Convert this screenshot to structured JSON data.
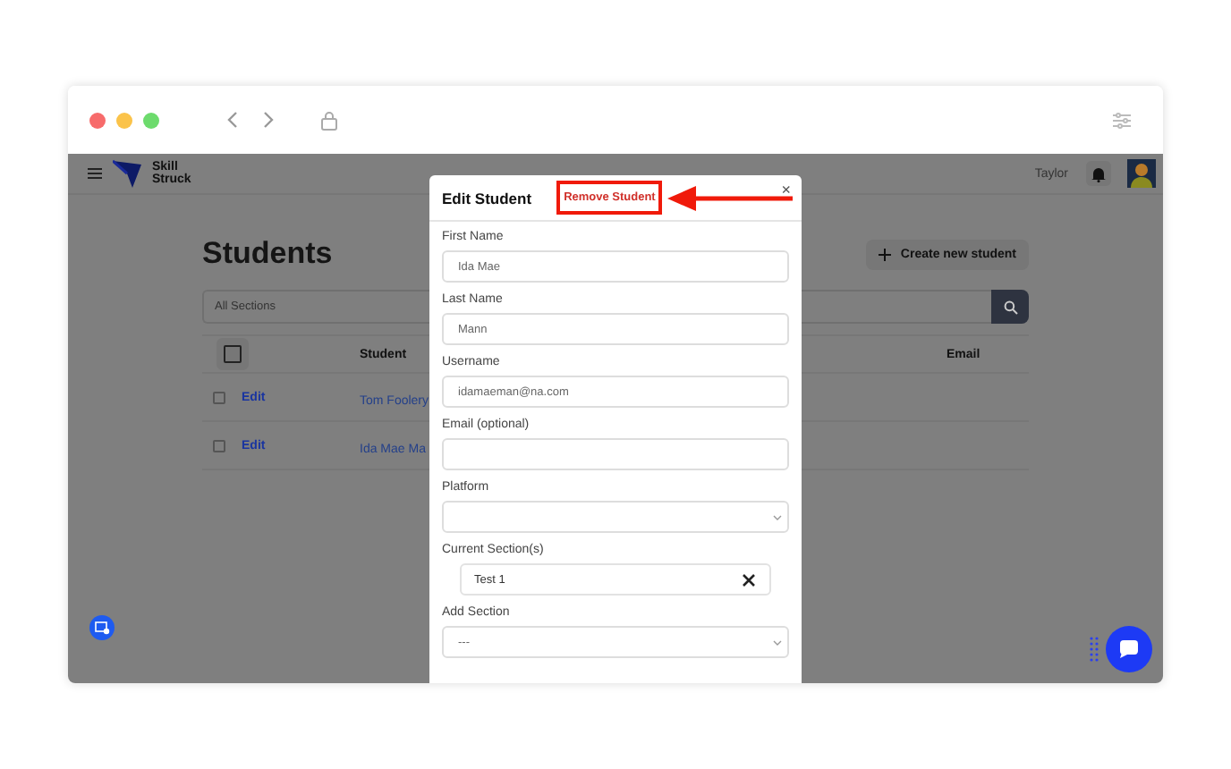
{
  "app": {
    "brand_lines": [
      "Skill",
      "Struck"
    ],
    "user_name": "Taylor"
  },
  "page": {
    "title": "Students",
    "create_button": "Create new student",
    "section_filter": {
      "value": "All Sections"
    },
    "table": {
      "header_checkbox": {
        "checked": false
      },
      "columns": [
        "Student",
        "Email"
      ],
      "rows": [
        {
          "checked": false,
          "action": "Edit",
          "student": "Tom Foolery"
        },
        {
          "checked": false,
          "action": "Edit",
          "student": "Ida Mae Ma"
        }
      ]
    }
  },
  "modal": {
    "title": "Edit Student",
    "remove_link": "Remove Student",
    "close": "×",
    "fields": [
      {
        "kind": "text",
        "label": "First Name",
        "value": "Ida Mae"
      },
      {
        "kind": "text",
        "label": "Last Name",
        "value": "Mann"
      },
      {
        "kind": "text",
        "label": "Username",
        "value": "idamaeman@na.com"
      },
      {
        "kind": "text",
        "label": "Email (optional)"
      },
      {
        "kind": "select",
        "label": "Platform"
      },
      {
        "kind": "chips",
        "label": "Current Section(s)",
        "chips": [
          "Test 1"
        ]
      },
      {
        "kind": "select",
        "label": "Add Section",
        "value": "---"
      }
    ]
  }
}
